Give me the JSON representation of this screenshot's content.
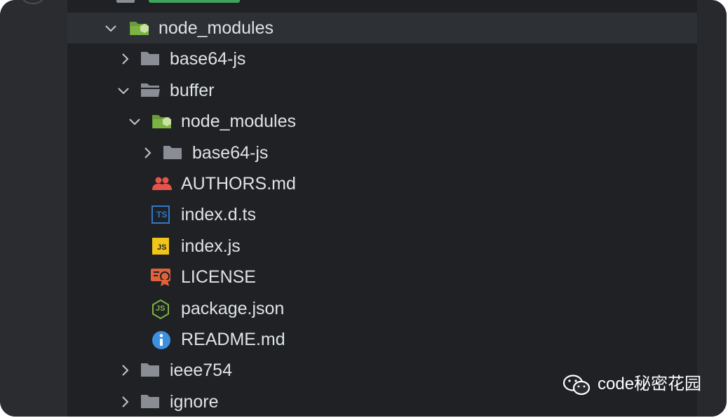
{
  "explorer": {
    "items": [
      {
        "label": "node_modules",
        "kind": "folder-special",
        "expanded": true,
        "depth": 0
      },
      {
        "label": "base64-js",
        "kind": "folder",
        "expanded": false,
        "depth": 1
      },
      {
        "label": "buffer",
        "kind": "folder",
        "expanded": true,
        "depth": 1
      },
      {
        "label": "node_modules",
        "kind": "folder-special",
        "expanded": true,
        "depth": 2
      },
      {
        "label": "base64-js",
        "kind": "folder",
        "expanded": false,
        "depth": 3
      },
      {
        "label": "AUTHORS.md",
        "kind": "authors-icon",
        "depth": 2
      },
      {
        "label": "index.d.ts",
        "kind": "ts-icon",
        "depth": 2
      },
      {
        "label": "index.js",
        "kind": "js-icon",
        "depth": 2
      },
      {
        "label": "LICENSE",
        "kind": "license-icon",
        "depth": 2
      },
      {
        "label": "package.json",
        "kind": "nodejs-icon",
        "depth": 2
      },
      {
        "label": "README.md",
        "kind": "info-icon",
        "depth": 2
      },
      {
        "label": "ieee754",
        "kind": "folder",
        "expanded": false,
        "depth": 1
      },
      {
        "label": "ignore",
        "kind": "folder",
        "expanded": false,
        "depth": 1
      }
    ],
    "icon_text": {
      "ts": "TS",
      "js": "JS",
      "node": "JS"
    }
  },
  "watermark": {
    "text": "code秘密花园",
    "icon": "wechat-icon"
  },
  "colors": {
    "background": "#1f2124",
    "text": "#e0e3e6",
    "folder": "#8a8e94",
    "folder_special": "#7cb342",
    "authors": "#e5534b",
    "ts": "#3178c6",
    "js": "#f0c419",
    "license": "#e0623a",
    "nodejs": "#7cb342",
    "info": "#3d8fe0"
  }
}
